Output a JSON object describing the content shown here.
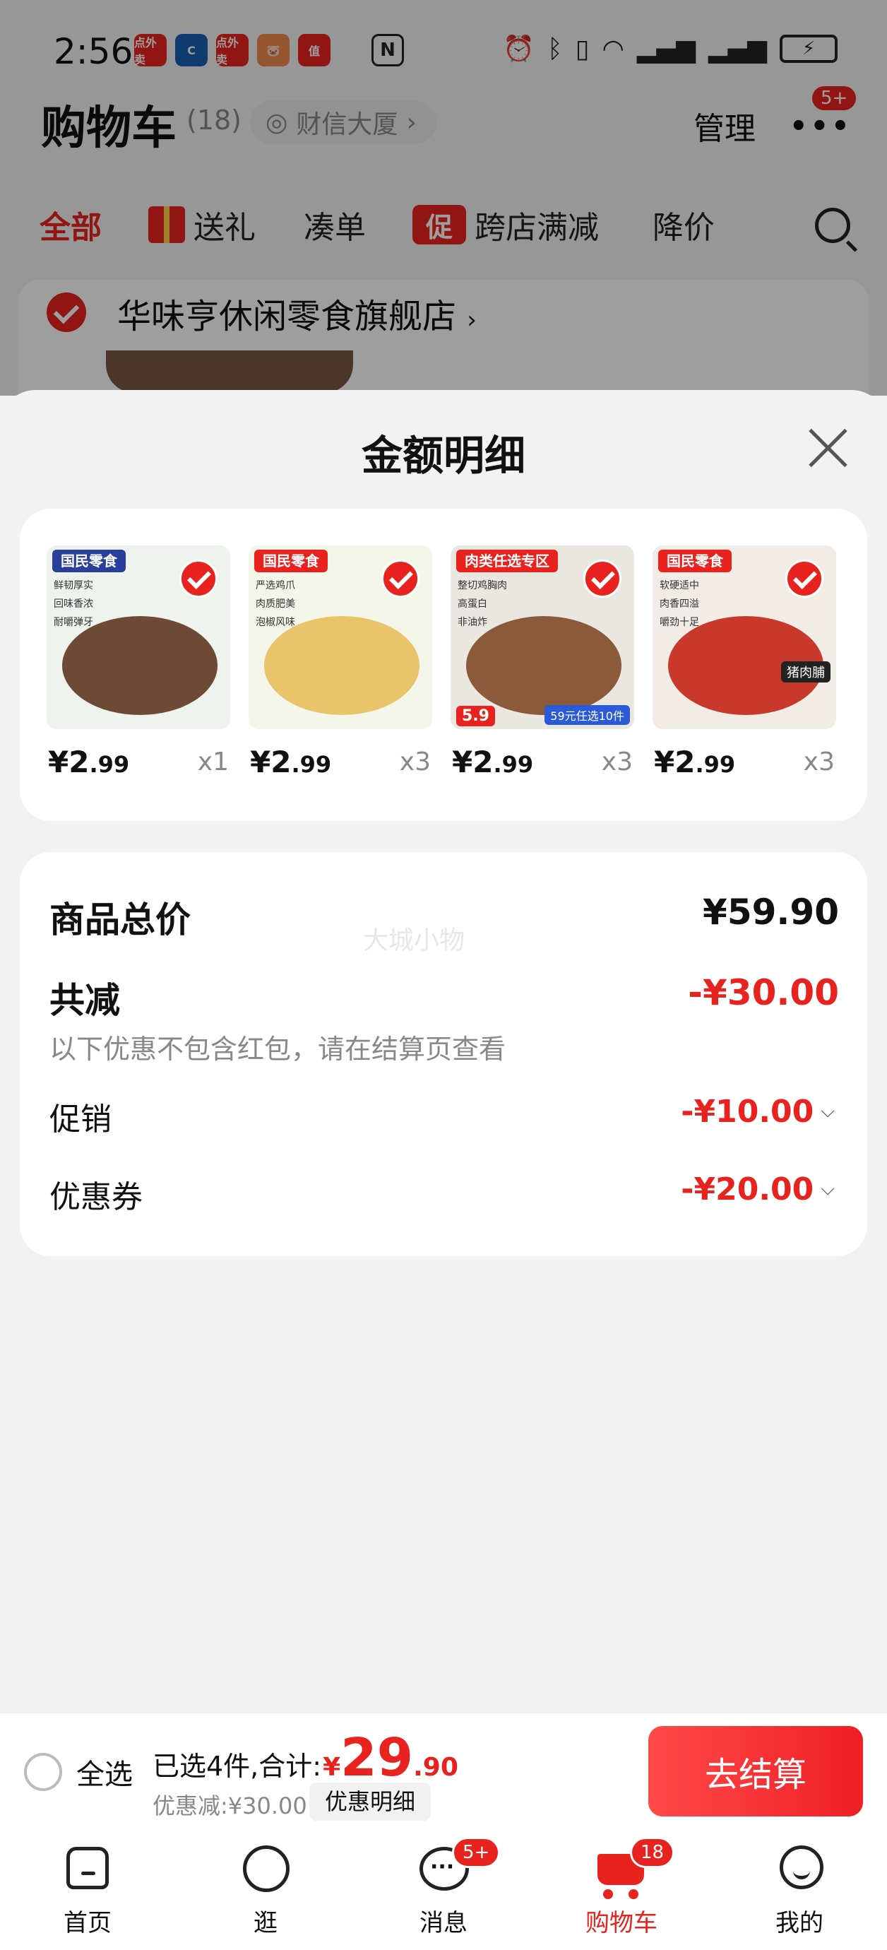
{
  "status_bar": {
    "time": "2:56",
    "apps": [
      {
        "icon": "app-icon-takeout",
        "color": "#e8231f",
        "text": "点外卖"
      },
      {
        "icon": "app-icon-bank",
        "color": "#1a5fb4",
        "text": "C"
      },
      {
        "icon": "app-icon-takeout",
        "color": "#e8231f",
        "text": "点外卖"
      },
      {
        "icon": "app-icon-pig",
        "color": "#f08a4b",
        "text": "🐷"
      },
      {
        "icon": "app-icon-zhi",
        "color": "#e8231f",
        "text": "值"
      }
    ],
    "right_icons": [
      "nfc-icon",
      "alarm-icon",
      "bluetooth-icon",
      "vibrate-icon",
      "wifi-icon",
      "signal-icon",
      "signal-icon",
      "battery-charging-icon"
    ]
  },
  "header": {
    "title": "购物车",
    "count": "(18)",
    "address": "财信大厦",
    "manage": "管理",
    "more_badge": "5+"
  },
  "filter_tabs": [
    {
      "label": "全部",
      "active": true
    },
    {
      "label": "送礼",
      "icon": "gift-icon"
    },
    {
      "label": "凑单"
    },
    {
      "label": "跨店满减",
      "badge": "促"
    },
    {
      "label": "降价"
    }
  ],
  "store": {
    "name": "华味亨休闲零食旗舰店",
    "chevron": "›"
  },
  "sheet": {
    "title": "金额明细",
    "products": [
      {
        "price_int": "¥2",
        "price_dec": ".99",
        "qty": "x1",
        "brand": "国民零食",
        "tags": [
          "鲜韧厚实",
          "回味香浓",
          "耐嚼弹牙"
        ],
        "bg": "#eef3ee",
        "food": "#6d4a36"
      },
      {
        "price_int": "¥2",
        "price_dec": ".99",
        "qty": "x3",
        "brand": "国民零食",
        "tags": [
          "严选鸡爪",
          "肉质肥美",
          "泡椒风味"
        ],
        "bg": "#f3f6e8",
        "food": "#e9c46a"
      },
      {
        "price_int": "¥2",
        "price_dec": ".99",
        "qty": "x3",
        "brand": "肉类任选专区",
        "tags": [
          "整切鸡胸肉",
          "高蛋白",
          "非油炸"
        ],
        "bg": "#eae7e0",
        "food": "#8a5a3a",
        "promo": "5.9",
        "promo_text": "59元任选10件"
      },
      {
        "price_int": "¥2",
        "price_dec": ".99",
        "qty": "x3",
        "brand": "国民零食",
        "tags": [
          "软硬适中",
          "肉香四溢",
          "嚼劲十足"
        ],
        "bg": "#f2ece6",
        "food": "#c8392b",
        "label": "猪肉脯"
      }
    ],
    "watermark": "大城小物",
    "total_label": "商品总价",
    "total_value": "¥59.90",
    "reduce_label": "共减",
    "reduce_value": "-¥30.00",
    "note": "以下优惠不包含红包，请在结算页查看",
    "promo_label": "促销",
    "promo_value": "-¥10.00",
    "coupon_label": "优惠券",
    "coupon_value": "-¥20.00"
  },
  "action_bar": {
    "select_all": "全选",
    "selected_text": "已选4件,合计:",
    "yen": "¥",
    "total_int": "29",
    "total_dec": ".90",
    "discount_text": "优惠减:¥30.00",
    "detail_button": "优惠明细",
    "checkout": "去结算"
  },
  "tab_bar": [
    {
      "label": "首页",
      "icon": "home-icon"
    },
    {
      "label": "逛",
      "icon": "browse-icon"
    },
    {
      "label": "消息",
      "icon": "message-icon",
      "badge": "5+"
    },
    {
      "label": "购物车",
      "icon": "cart-icon",
      "badge": "18",
      "active": true
    },
    {
      "label": "我的",
      "icon": "profile-icon"
    }
  ],
  "colors": {
    "accent": "#e8231f",
    "muted": "#888888"
  }
}
